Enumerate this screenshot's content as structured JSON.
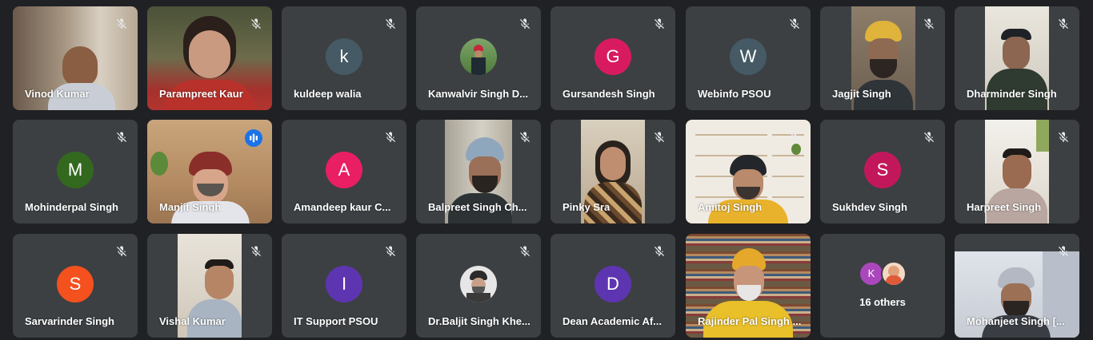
{
  "participants": [
    {
      "name": "Vinod Kumar",
      "muted": true
    },
    {
      "name": "Parampreet Kaur",
      "muted": true
    },
    {
      "name": "kuldeep walia",
      "initial": "k",
      "color": "#455a64",
      "muted": true
    },
    {
      "name": "Kanwalvir Singh D...",
      "muted": true
    },
    {
      "name": "Gursandesh Singh",
      "initial": "G",
      "color": "#d81b60",
      "muted": true
    },
    {
      "name": "Webinfo PSOU",
      "initial": "W",
      "color": "#455a64",
      "muted": true
    },
    {
      "name": "Jagjit Singh",
      "muted": true
    },
    {
      "name": "Dharminder Singh",
      "muted": true
    },
    {
      "name": "Mohinderpal Singh",
      "initial": "M",
      "color": "#33691e",
      "muted": true
    },
    {
      "name": "Manjit Singh",
      "muted": false,
      "speaking": true
    },
    {
      "name": "Amandeep kaur C...",
      "initial": "A",
      "color": "#e91e63",
      "muted": true
    },
    {
      "name": "Balpreet Singh Ch...",
      "muted": true
    },
    {
      "name": "Pinky Sra",
      "muted": true
    },
    {
      "name": "Amitoj Singh",
      "muted": true
    },
    {
      "name": "Sukhdev Singh",
      "initial": "S",
      "color": "#c2185b",
      "muted": true
    },
    {
      "name": "Harpreet Singh",
      "muted": true
    },
    {
      "name": "Sarvarinder Singh",
      "initial": "S",
      "color": "#f4511e",
      "muted": true
    },
    {
      "name": "Vishal Kumar",
      "muted": true
    },
    {
      "name": "IT Support PSOU",
      "initial": "I",
      "color": "#5e35b1",
      "muted": true
    },
    {
      "name": "Dr.Baljit Singh Khe...",
      "muted": true
    },
    {
      "name": "Dean Academic Af...",
      "initial": "D",
      "color": "#5e35b1",
      "muted": true
    },
    {
      "name": "Rajinder Pal Singh ...",
      "muted": false
    },
    {
      "name": "Mohanjeet Singh [...",
      "muted": true
    }
  ],
  "others": {
    "label": "16 others",
    "avatar_initial": "K",
    "avatar_color": "#ab47bc"
  },
  "colors": {
    "background": "#202124",
    "tile": "#3c4043",
    "active_border": "#8ab4f8",
    "speaking_indicator": "#1a73e8"
  }
}
